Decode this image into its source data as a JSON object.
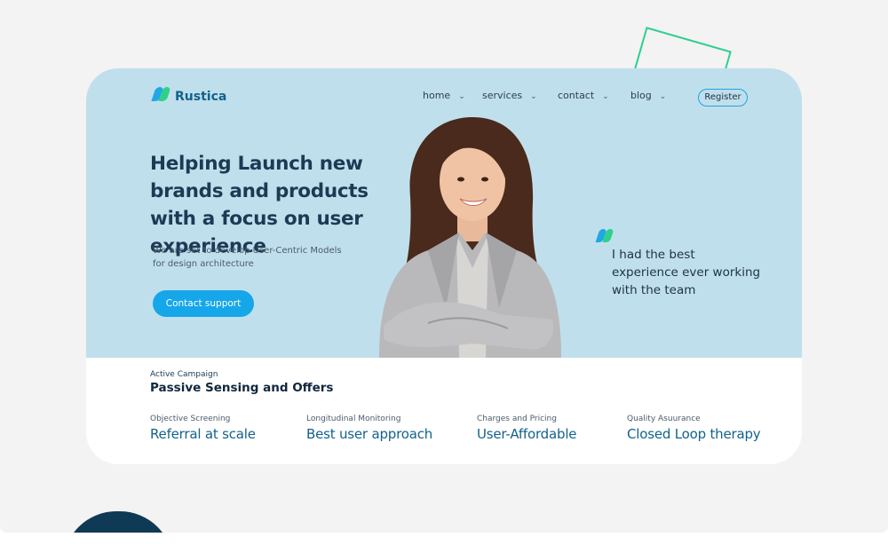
{
  "brand": {
    "name": "Rustica"
  },
  "nav": {
    "items": [
      {
        "label": "home"
      },
      {
        "label": "services"
      },
      {
        "label": "contact"
      },
      {
        "label": "blog"
      }
    ],
    "register_label": "Register"
  },
  "hero": {
    "headline": "Helping Launch new brands and products with a focus on user experience",
    "subtext": "We are set to develop User-Centric Models for design architecture",
    "cta_label": "Contact support",
    "testimonial": "I had the best experience ever working with the team"
  },
  "campaign": {
    "label": "Active Campaign",
    "title": "Passive Sensing and Offers"
  },
  "features": [
    {
      "label": "Objective Screening",
      "value": "Referral at scale"
    },
    {
      "label": "Longitudinal Monitoring",
      "value": "Best user approach"
    },
    {
      "label": "Charges and Pricing",
      "value": "User-Affordable"
    },
    {
      "label": "Quality Asuurance",
      "value": "Closed Loop therapy"
    }
  ],
  "colors": {
    "hero_background": "#c0dfec",
    "accent_blue": "#15a7ea",
    "accent_green": "#2fd18a",
    "brand_dark": "#13628c"
  }
}
